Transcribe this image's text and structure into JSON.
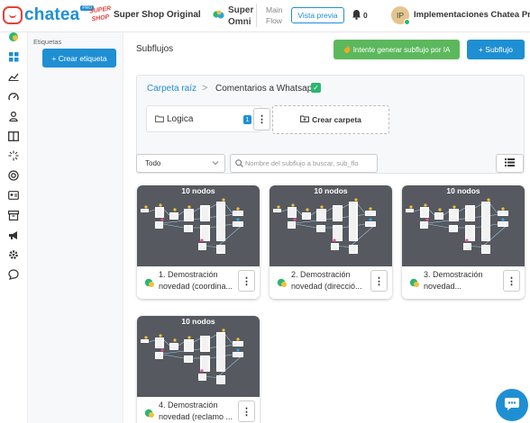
{
  "header": {
    "logo_text": "chatea",
    "logo_badge": "PRO",
    "shop_logo_text": "SUPER SHOP",
    "shop_name": "Super Shop Original",
    "omni_name": "Super Omni",
    "flow_name": "Main Flow",
    "preview_label": "Vista previa",
    "notifications_count": "0",
    "avatar_initials": "IP",
    "company_name": "Implementaciones Chatea Pro"
  },
  "rail": {
    "icons": [
      "whatsapp-icon",
      "dashboard-grid-icon",
      "chart-icon",
      "speed-icon",
      "user-icon",
      "columns-icon",
      "sparkle-icon",
      "support-icon",
      "contact-card-icon",
      "archive-icon",
      "megaphone-icon",
      "settings-cog-icon",
      "chat-bubble-icon"
    ]
  },
  "tags": {
    "title": "Etiquetas",
    "create_label": "+ Crear etiqueta"
  },
  "main": {
    "title": "Subflujos",
    "ai_button_label": "Intente generar subflujo por IA",
    "add_button_label": "+ Subflujo",
    "breadcrumb": {
      "root": "Carpeta raíz",
      "separator": ">",
      "current": "Comentarios a Whatsapp"
    },
    "folder": {
      "name": "Logica",
      "count": "1"
    },
    "create_folder_label": "Crear carpeta",
    "filter": {
      "selected": "Todo"
    },
    "search": {
      "placeholder": "Nombre del subflujo a buscar, sub_flo",
      "value": ""
    }
  },
  "subflows": [
    {
      "nodes": "10 nodos",
      "title_line1": "1. Demostración",
      "title_line2": "novedad (coordina..."
    },
    {
      "nodes": "10 nodos",
      "title_line1": "2. Demostración",
      "title_line2": "novedad (direcció..."
    },
    {
      "nodes": "10 nodos",
      "title_line1": "3. Demostración",
      "title_line2": "novedad..."
    },
    {
      "nodes": "10 nodos",
      "title_line1": "4. Demostración",
      "title_line2": "novedad (reclamo ..."
    }
  ],
  "colors": {
    "primary": "#1f8fd3",
    "success": "#5cb85c",
    "brand_red": "#e8413a",
    "preview_bg": "#56595f"
  }
}
